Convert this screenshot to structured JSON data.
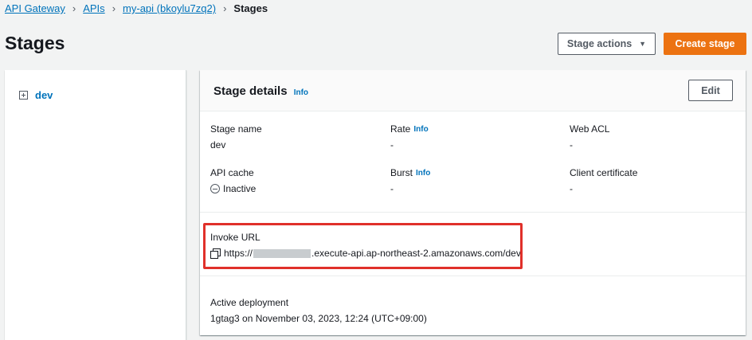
{
  "breadcrumb": {
    "items": [
      "API Gateway",
      "APIs",
      "my-api (bkoylu7zq2)"
    ],
    "current": "Stages"
  },
  "page": {
    "title": "Stages"
  },
  "actions": {
    "stage_actions_label": "Stage actions",
    "create_stage_label": "Create stage"
  },
  "stage_tree": {
    "items": [
      "dev"
    ]
  },
  "stage_details": {
    "title": "Stage details",
    "info_label": "Info",
    "edit_label": "Edit",
    "stage_name_label": "Stage name",
    "stage_name_value": "dev",
    "rate_label": "Rate",
    "rate_value": "-",
    "web_acl_label": "Web ACL",
    "web_acl_value": "-",
    "api_cache_label": "API cache",
    "api_cache_value": "Inactive",
    "burst_label": "Burst",
    "burst_value": "-",
    "client_certificate_label": "Client certificate",
    "client_certificate_value": "-",
    "invoke_url_label": "Invoke URL",
    "invoke_url_prefix": "https://",
    "invoke_url_suffix": ".execute-api.ap-northeast-2.amazonaws.com/dev",
    "active_deployment_label": "Active deployment",
    "active_deployment_value": "1gtag3 on November 03, 2023, 12:24 (UTC+09:00)"
  },
  "colors": {
    "link": "#0073bb",
    "primary_button": "#ec7211",
    "highlight_border": "#e0302a"
  },
  "icons": {
    "breadcrumb_separator": "chevron-right-icon",
    "stage_actions_caret": "caret-down-icon",
    "tree_expand": "plus-square-icon",
    "status_inactive": "minus-circle-icon",
    "copy": "copy-icon"
  }
}
